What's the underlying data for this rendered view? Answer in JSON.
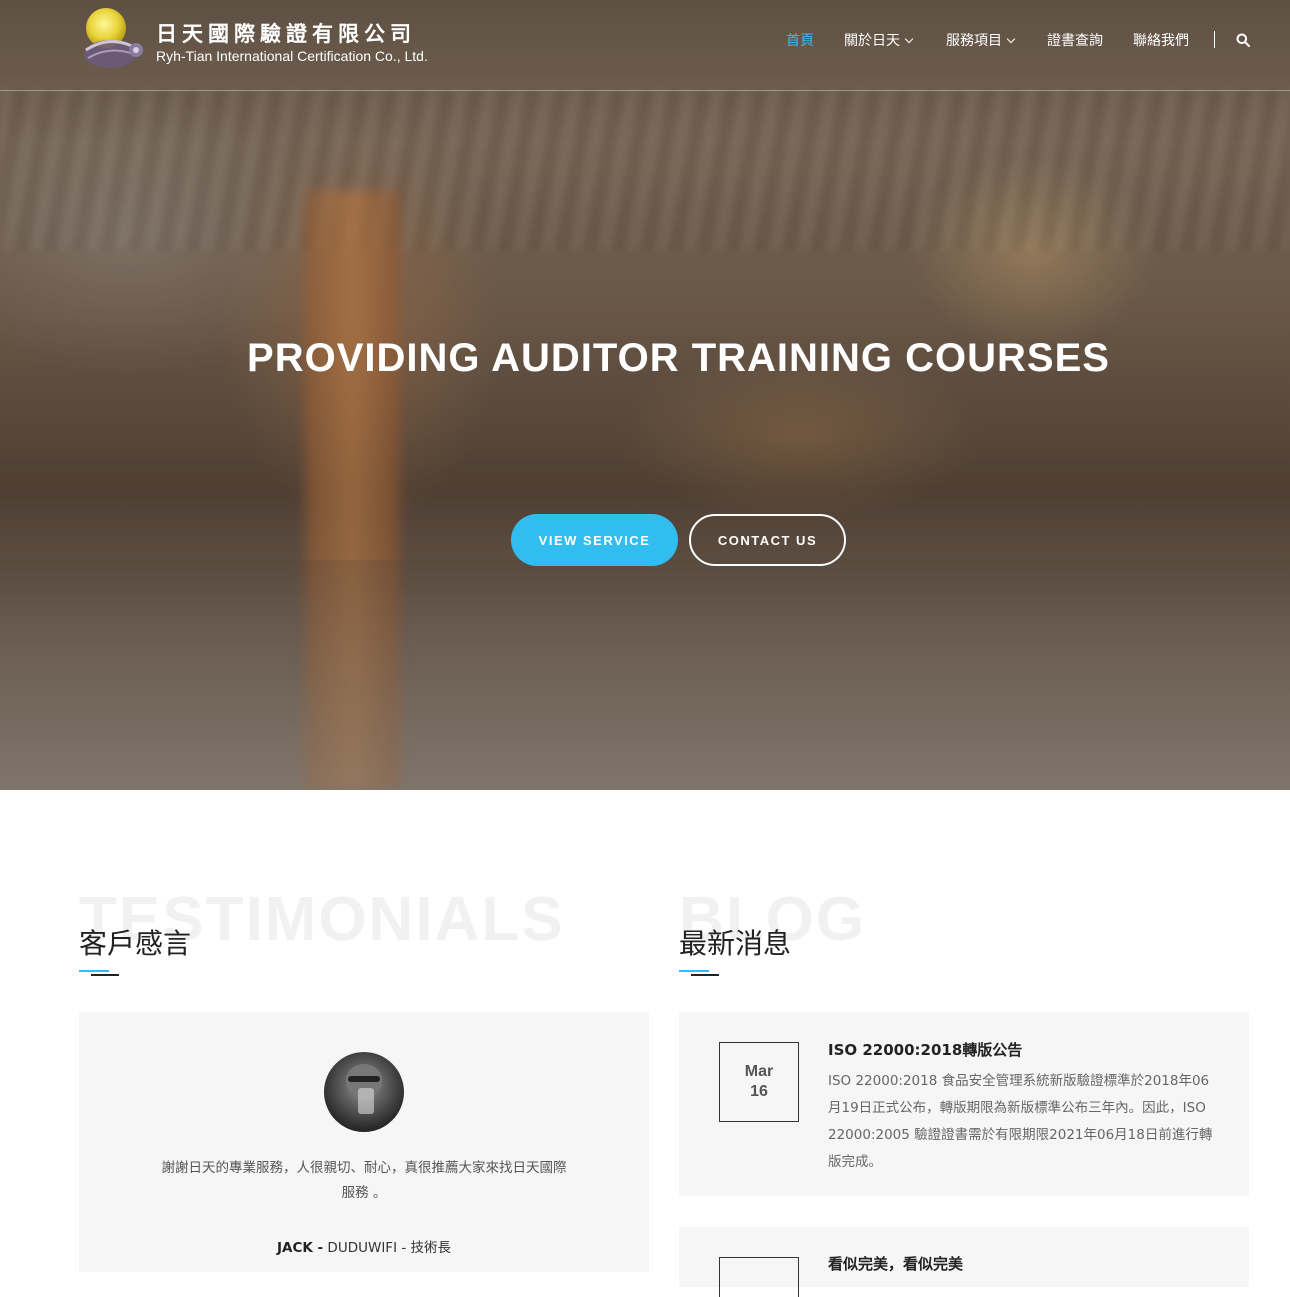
{
  "brand": {
    "name_cn": "日天國際驗證有限公司",
    "name_en": "Ryh-Tian International Certification Co., Ltd."
  },
  "nav": {
    "items": [
      {
        "label": "首頁",
        "active": true,
        "dropdown": false
      },
      {
        "label": "關於日天",
        "active": false,
        "dropdown": true
      },
      {
        "label": "服務項目",
        "active": false,
        "dropdown": true
      },
      {
        "label": "證書查詢",
        "active": false,
        "dropdown": false
      },
      {
        "label": "聯絡我們",
        "active": false,
        "dropdown": false
      }
    ],
    "search_icon": "search-icon"
  },
  "hero": {
    "title": "PROVIDING AUDITOR TRAINING COURSES",
    "primary_button": "VIEW SERVICE",
    "secondary_button": "CONTACT US"
  },
  "testimonials": {
    "bg_label": "TESTIMONIALS",
    "title": "客戶感言",
    "items": [
      {
        "quote": "謝謝日天的專業服務，人很親切、耐心，真很推薦大家來找日天國際服務 。",
        "author_name": "JACK -",
        "author_company": "DUDUWIFI - 技術長"
      }
    ]
  },
  "blog": {
    "bg_label": "BLOG",
    "title": "最新消息",
    "posts": [
      {
        "month": "Mar",
        "day": "16",
        "title": "ISO 22000:2018轉版公告",
        "excerpt": "ISO 22000:2018 食品安全管理系統新版驗證標準於2018年06月19日正式公布，轉版期限為新版標準公布三年內。因此，ISO 22000:2005 驗證證書需於有限期限2021年06月18日前進行轉版完成。"
      },
      {
        "title": "看似完美，看似完美"
      }
    ]
  },
  "colors": {
    "accent": "#31bdf0",
    "dark": "#222222",
    "card_bg": "#f6f6f6"
  }
}
